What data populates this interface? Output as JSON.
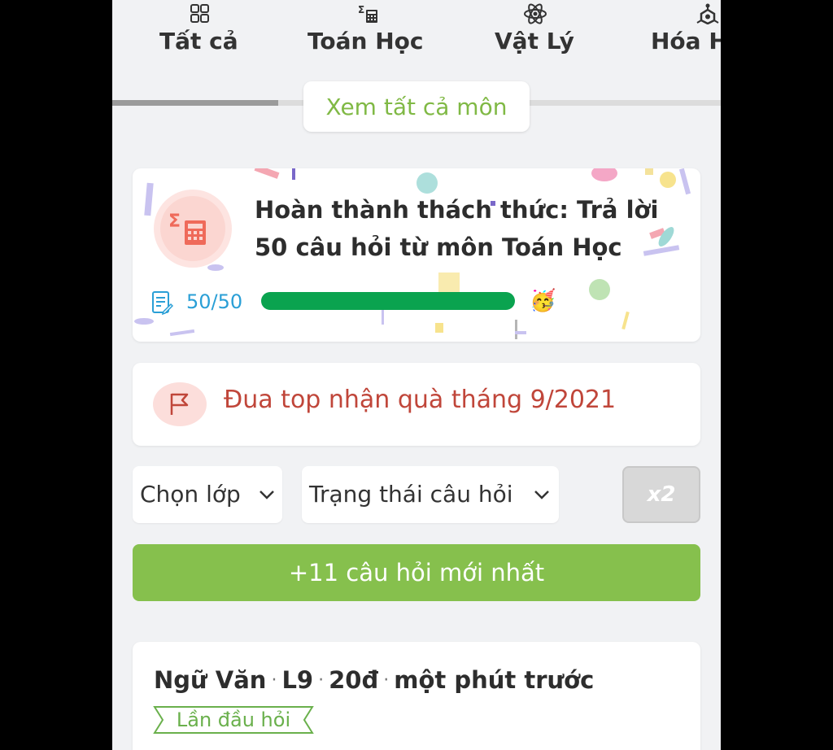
{
  "tabs": [
    {
      "label": "Tất cả",
      "icon": "grid-icon"
    },
    {
      "label": "Toán Học",
      "icon": "calculator-icon"
    },
    {
      "label": "Vật Lý",
      "icon": "atom-icon"
    },
    {
      "label": "Hóa H",
      "icon": "molecule-icon"
    }
  ],
  "see_all_label": "Xem tất cả môn",
  "challenge": {
    "title_line1": "Hoàn thành thách thức: Trả lời",
    "title_line2": "50 câu hỏi  từ môn Toán Học",
    "progress_text": "50/50",
    "progress_value": 1.0,
    "icon": "calculator-icon",
    "celebration_icon": "party-face-icon"
  },
  "race": {
    "label": "Đua top nhận quà tháng 9/2021",
    "icon": "flag-icon"
  },
  "filters": {
    "class_label": "Chọn lớp",
    "status_label": "Trạng thái câu hỏi",
    "multiplier": "x2"
  },
  "new_questions_label": "+11 câu hỏi mới nhất",
  "question": {
    "subject": "Ngữ Văn",
    "grade": "L9",
    "points": "20đ",
    "time": "một phút trước",
    "tag": "Lần đầu hỏi"
  },
  "colors": {
    "accent_green": "#86c04d",
    "progress_green": "#0aa34f",
    "race_red": "#c0463a",
    "link_blue": "#2a9fd6"
  }
}
